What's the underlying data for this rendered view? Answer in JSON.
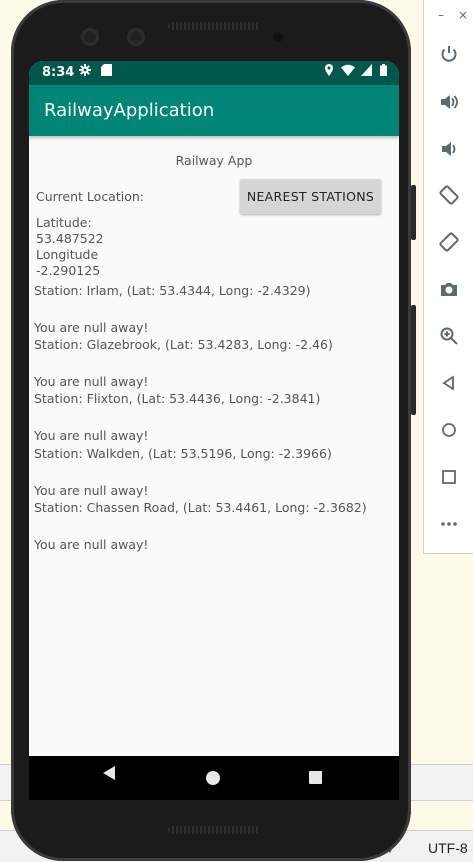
{
  "ide": {
    "encoding_label": "UTF-8",
    "status_left_text": "rl"
  },
  "emulator_toolbar": {
    "top_controls": [
      "–",
      "×"
    ],
    "buttons": [
      {
        "name": "power",
        "glyph": "⏻"
      },
      {
        "name": "volume-up",
        "glyph": "🔊"
      },
      {
        "name": "volume-down",
        "glyph": "🔉"
      },
      {
        "name": "rotate-left",
        "glyph": "⟲"
      },
      {
        "name": "rotate-right",
        "glyph": "⟳"
      },
      {
        "name": "screenshot",
        "glyph": "📷"
      },
      {
        "name": "zoom",
        "glyph": "⊕"
      },
      {
        "name": "back",
        "glyph": "◁"
      },
      {
        "name": "home",
        "glyph": "○"
      },
      {
        "name": "overview",
        "glyph": "□"
      },
      {
        "name": "more",
        "glyph": "⋯"
      }
    ]
  },
  "status_bar": {
    "time": "8:34",
    "left_icons": [
      "gear-icon",
      "sd-card-icon"
    ],
    "right_icons": [
      "location-icon",
      "wifi-icon",
      "signal-icon",
      "battery-icon"
    ]
  },
  "app_bar": {
    "title": "RailwayApplication",
    "color": "#008577",
    "status_color": "#00574b"
  },
  "content": {
    "header": "Railway App",
    "current_location_label": "Current Location:",
    "nearest_button_label": "NEAREST STATIONS",
    "latitude_label": "Latitude:",
    "latitude_value": "53.487522",
    "longitude_label": "Longitude",
    "longitude_value": "-2.290125",
    "stations": [
      {
        "line": "Station: Irlam, (Lat: 53.4344, Long: -2.4329)",
        "distance": "You are null away!"
      },
      {
        "line": "Station: Glazebrook, (Lat: 53.4283, Long: -2.46)",
        "distance": "You are null away!"
      },
      {
        "line": "Station: Flixton, (Lat: 53.4436, Long: -2.3841)",
        "distance": "You are null away!"
      },
      {
        "line": "Station: Walkden, (Lat: 53.5196, Long: -2.3966)",
        "distance": "You are null away!"
      },
      {
        "line": "Station: Chassen Road, (Lat: 53.4461, Long: -2.3682)",
        "distance": "You are null away!"
      }
    ]
  }
}
